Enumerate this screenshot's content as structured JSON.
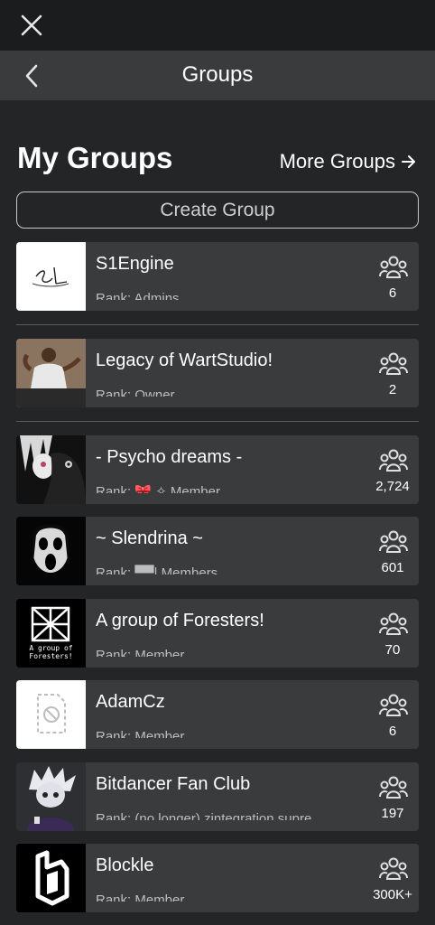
{
  "header": {
    "title": "Groups"
  },
  "section": {
    "title": "My Groups",
    "more_label": "More Groups",
    "create_label": "Create Group"
  },
  "groups": [
    {
      "name": "S1Engine",
      "rank": "Rank: Admins",
      "members": "6"
    },
    {
      "name": "Legacy of WartStudio!",
      "rank": "Rank: Owner",
      "members": "2"
    },
    {
      "name": "- Psycho dreams -",
      "rank": "Rank: 🎀 ✧ Member",
      "members": "2,724"
    },
    {
      "name": "~ Slendrina ~",
      "rank": "Rank: ▀▀| Members",
      "members": "601"
    },
    {
      "name": "A group of Foresters!",
      "rank": "Rank: Member",
      "members": "70",
      "logo_text": "A group of\nForesters!"
    },
    {
      "name": "AdamCz",
      "rank": "Rank: Member",
      "members": "6"
    },
    {
      "name": "Bitdancer Fan Club",
      "rank": "Rank: (no longer) zintegration supre",
      "members": "197"
    },
    {
      "name": "Blockle",
      "rank": "Rank: Member",
      "members": "300K+"
    }
  ],
  "icons": {
    "close": "close-icon",
    "back": "chevron-left-icon",
    "arrow": "arrow-right-icon",
    "members": "members-icon"
  },
  "colors": {
    "background": "#232527",
    "card": "#393b3d",
    "topbar": "#1b1c1e",
    "navbar": "#393b3d"
  }
}
